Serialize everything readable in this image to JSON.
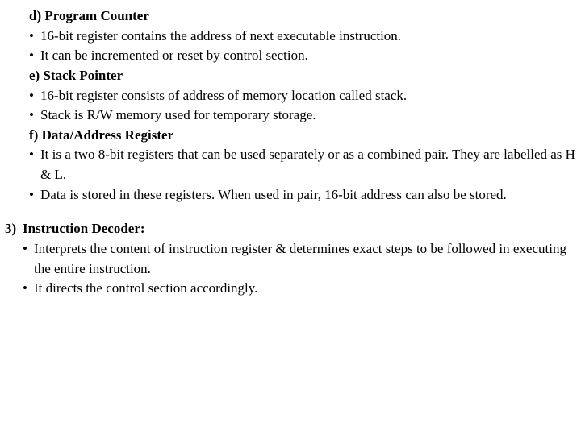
{
  "section_d": {
    "heading": "d) Program Counter",
    "bullets": [
      "16-bit register contains the address of next executable instruction.",
      "It can be incremented or reset by control section."
    ]
  },
  "section_e": {
    "heading": "e)  Stack Pointer",
    "bullets": [
      "16-bit register consists of address of memory location called stack.",
      "Stack is R/W memory used for temporary storage."
    ]
  },
  "section_f": {
    "heading": "f)  Data/Address Register",
    "bullets": [
      "It is a two 8-bit registers that can be used separately or as a combined pair. They are labelled as H & L.",
      "Data is stored in these registers. When used in pair, 16-bit address can also be stored."
    ]
  },
  "section_3": {
    "number": "3)",
    "heading": "Instruction Decoder:",
    "bullets": [
      "Interprets the content of instruction register & determines exact steps to be followed in executing the entire instruction.",
      "It directs the control section accordingly."
    ]
  },
  "bullet_char": "•"
}
